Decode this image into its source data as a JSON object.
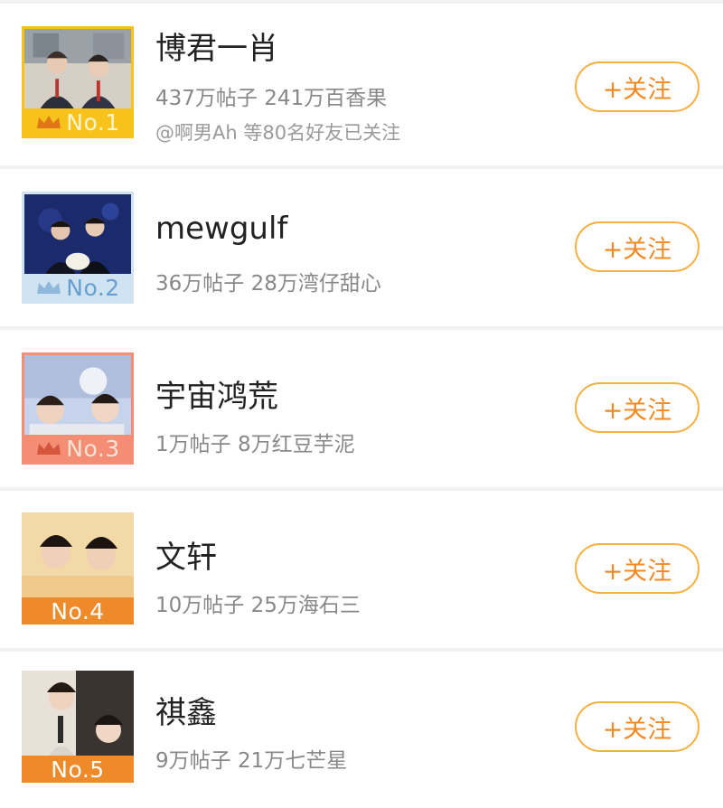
{
  "colors": {
    "accent": "#f08a24",
    "button_border": "#f5b041",
    "rank1": "#f7c21a",
    "rank2": "#cfe3f2",
    "rank3": "#f38d74",
    "rank4": "#ef8a2a",
    "rank5": "#ef8a2a"
  },
  "items": [
    {
      "name": "博君一肖",
      "stats": "437万帖子 241万百香果",
      "friends": "@啊男Ah 等80名好友已关注",
      "rank": "No.1",
      "crown": true,
      "follow": "+关注"
    },
    {
      "name": "mewgulf",
      "stats": "36万帖子 28万湾仔甜心",
      "rank": "No.2",
      "crown": true,
      "follow": "+关注"
    },
    {
      "name": "宇宙鸿荒",
      "stats": "1万帖子 8万红豆芋泥",
      "rank": "No.3",
      "crown": true,
      "follow": "+关注"
    },
    {
      "name": "文轩",
      "stats": "10万帖子 25万海石三",
      "rank": "No.4",
      "crown": false,
      "follow": "+关注"
    },
    {
      "name": "祺鑫",
      "stats": "9万帖子 21万七芒星",
      "rank": "No.5",
      "crown": false,
      "follow": "+关注"
    }
  ]
}
